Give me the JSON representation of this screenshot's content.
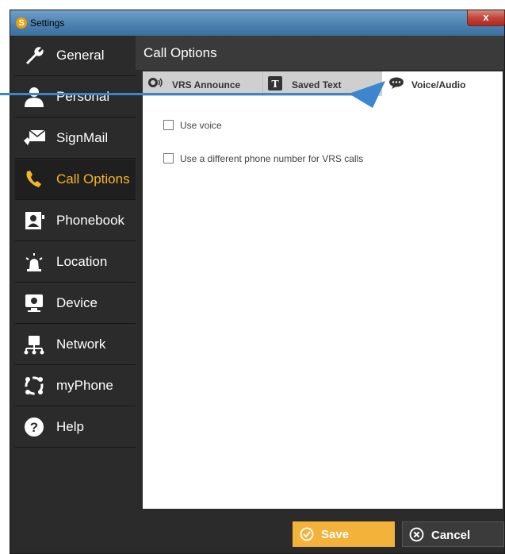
{
  "window": {
    "title": "Settings",
    "close_label": "x"
  },
  "sidebar": {
    "items": [
      {
        "label": "General",
        "icon": "wrench-icon"
      },
      {
        "label": "Personal",
        "icon": "person-icon"
      },
      {
        "label": "SignMail",
        "icon": "signmail-icon"
      },
      {
        "label": "Call Options",
        "icon": "phone-handset-icon"
      },
      {
        "label": "Phonebook",
        "icon": "phonebook-icon"
      },
      {
        "label": "Location",
        "icon": "location-alert-icon"
      },
      {
        "label": "Device",
        "icon": "monitor-icon"
      },
      {
        "label": "Network",
        "icon": "network-icon"
      },
      {
        "label": "myPhone",
        "icon": "myphone-icon"
      },
      {
        "label": "Help",
        "icon": "help-icon"
      }
    ],
    "active_index": 3
  },
  "main": {
    "title": "Call Options",
    "tabs": [
      {
        "label": "VRS Announce"
      },
      {
        "label": "Saved Text"
      },
      {
        "label": "Voice/Audio"
      }
    ],
    "active_tab": 2,
    "options": [
      {
        "label": "Use voice",
        "checked": false
      },
      {
        "label": "Use a different phone number for VRS calls",
        "checked": false
      }
    ]
  },
  "footer": {
    "save_label": "Save",
    "cancel_label": "Cancel"
  },
  "colors": {
    "accent": "#f4b825",
    "annotation_arrow": "#3b86cc"
  }
}
